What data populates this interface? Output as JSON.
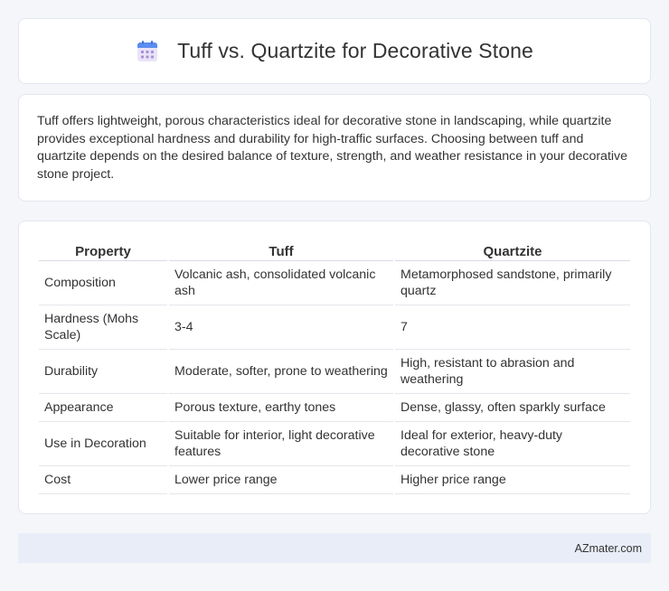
{
  "header": {
    "icon": "calendar-icon",
    "title": "Tuff vs. Quartzite for Decorative Stone"
  },
  "intro": {
    "text": "Tuff offers lightweight, porous characteristics ideal for decorative stone in landscaping, while quartzite provides exceptional hardness and durability for high-traffic surfaces. Choosing between tuff and quartzite depends on the desired balance of texture, strength, and weather resistance in your decorative stone project."
  },
  "table": {
    "headers": [
      "Property",
      "Tuff",
      "Quartzite"
    ],
    "rows": [
      [
        "Composition",
        "Volcanic ash, consolidated volcanic ash",
        "Metamorphosed sandstone, primarily quartz"
      ],
      [
        "Hardness (Mohs Scale)",
        "3-4",
        "7"
      ],
      [
        "Durability",
        "Moderate, softer, prone to weathering",
        "High, resistant to abrasion and weathering"
      ],
      [
        "Appearance",
        "Porous texture, earthy tones",
        "Dense, glassy, often sparkly surface"
      ],
      [
        "Use in Decoration",
        "Suitable for interior, light decorative features",
        "Ideal for exterior, heavy-duty decorative stone"
      ],
      [
        "Cost",
        "Lower price range",
        "Higher price range"
      ]
    ]
  },
  "footer": {
    "text": "AZmater.com"
  },
  "colors": {
    "background": "#f4f6fa",
    "card": "#ffffff",
    "footer": "#e8edf8",
    "icon_top": "#5b8def",
    "icon_body": "#e9e3f7"
  }
}
